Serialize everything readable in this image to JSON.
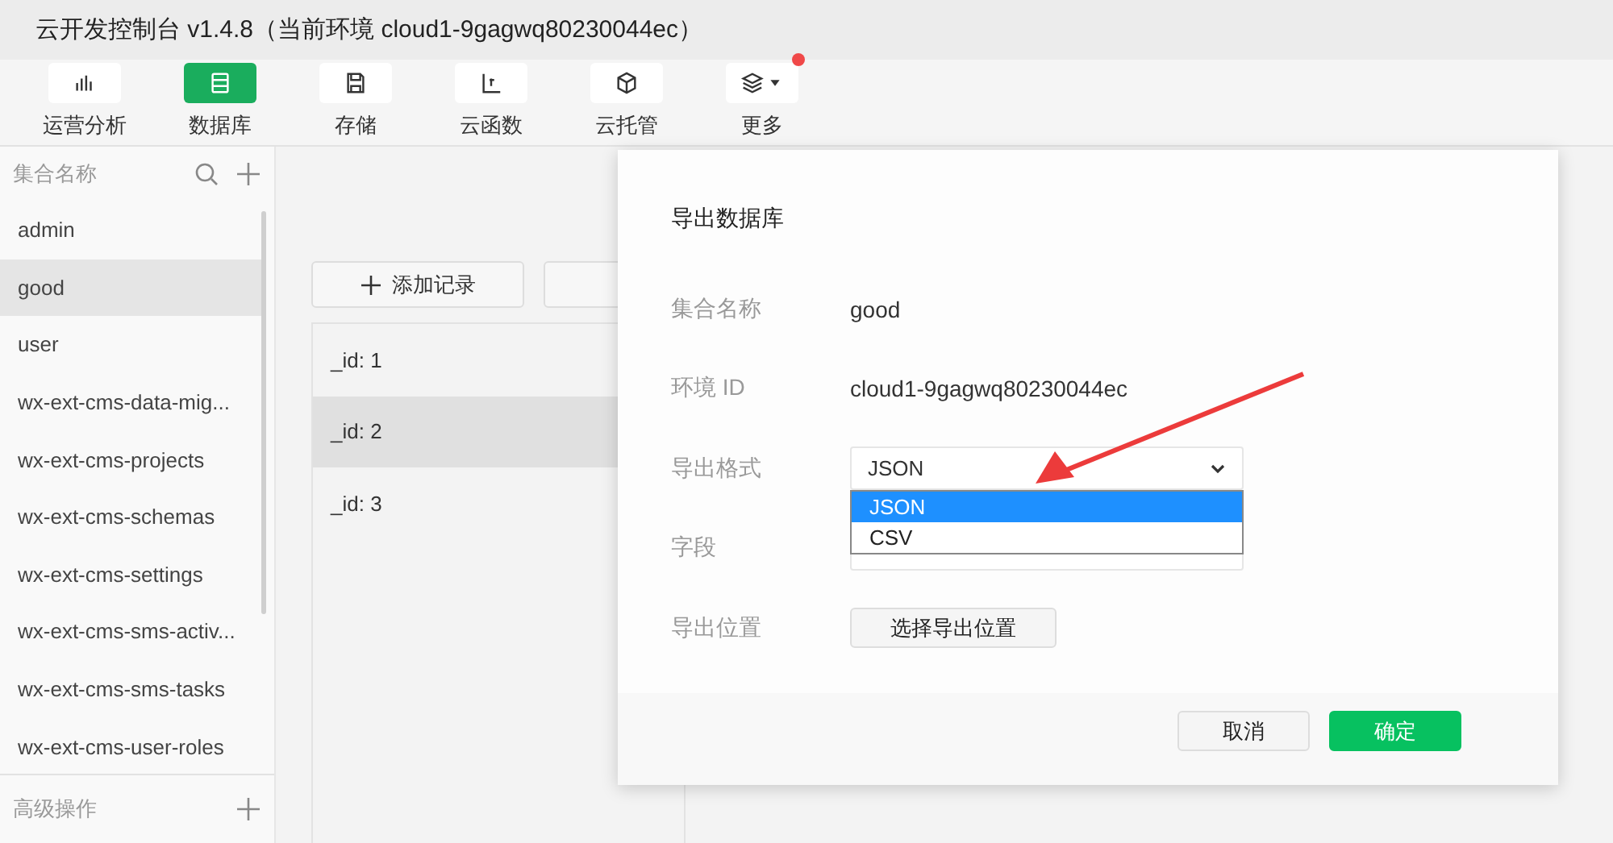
{
  "window": {
    "title": "云开发控制台 v1.4.8（当前环境 cloud1-9gagwq80230044ec）"
  },
  "toolbar": [
    {
      "label": "运营分析",
      "selected": false,
      "badge": false
    },
    {
      "label": "数据库",
      "selected": true,
      "badge": false
    },
    {
      "label": "存储",
      "selected": false,
      "badge": false
    },
    {
      "label": "云函数",
      "selected": false,
      "badge": false
    },
    {
      "label": "云托管",
      "selected": false,
      "badge": false
    },
    {
      "label": "更多",
      "selected": false,
      "badge": true
    }
  ],
  "sidebar": {
    "header": "集合名称",
    "items": [
      {
        "label": "admin",
        "selected": false
      },
      {
        "label": "good",
        "selected": true
      },
      {
        "label": "user",
        "selected": false
      },
      {
        "label": "wx-ext-cms-data-mig...",
        "selected": false
      },
      {
        "label": "wx-ext-cms-projects",
        "selected": false
      },
      {
        "label": "wx-ext-cms-schemas",
        "selected": false
      },
      {
        "label": "wx-ext-cms-settings",
        "selected": false
      },
      {
        "label": "wx-ext-cms-sms-activ...",
        "selected": false
      },
      {
        "label": "wx-ext-cms-sms-tasks",
        "selected": false
      },
      {
        "label": "wx-ext-cms-user-roles",
        "selected": false
      }
    ],
    "footer": "高级操作"
  },
  "main": {
    "add_button": "添加记录",
    "records": [
      {
        "label": "_id: 1",
        "selected": false
      },
      {
        "label": "_id: 2",
        "selected": true
      },
      {
        "label": "_id: 3",
        "selected": false
      }
    ]
  },
  "dialog": {
    "title": "导出数据库",
    "fields": [
      {
        "kind": "text",
        "label": "集合名称",
        "value": "good"
      },
      {
        "kind": "text",
        "label": "环境 ID",
        "value": "cloud1-9gagwq80230044ec"
      },
      {
        "kind": "select",
        "label": "导出格式",
        "value": "JSON",
        "options": [
          {
            "label": "JSON",
            "selected": true
          },
          {
            "label": "CSV",
            "selected": false
          }
        ]
      },
      {
        "kind": "input",
        "label": "字段"
      },
      {
        "kind": "button",
        "label": "导出位置",
        "value": "选择导出位置"
      }
    ],
    "buttons": [
      {
        "label": "取消",
        "kind": "secondary"
      },
      {
        "label": "确定",
        "kind": "primary"
      }
    ]
  }
}
